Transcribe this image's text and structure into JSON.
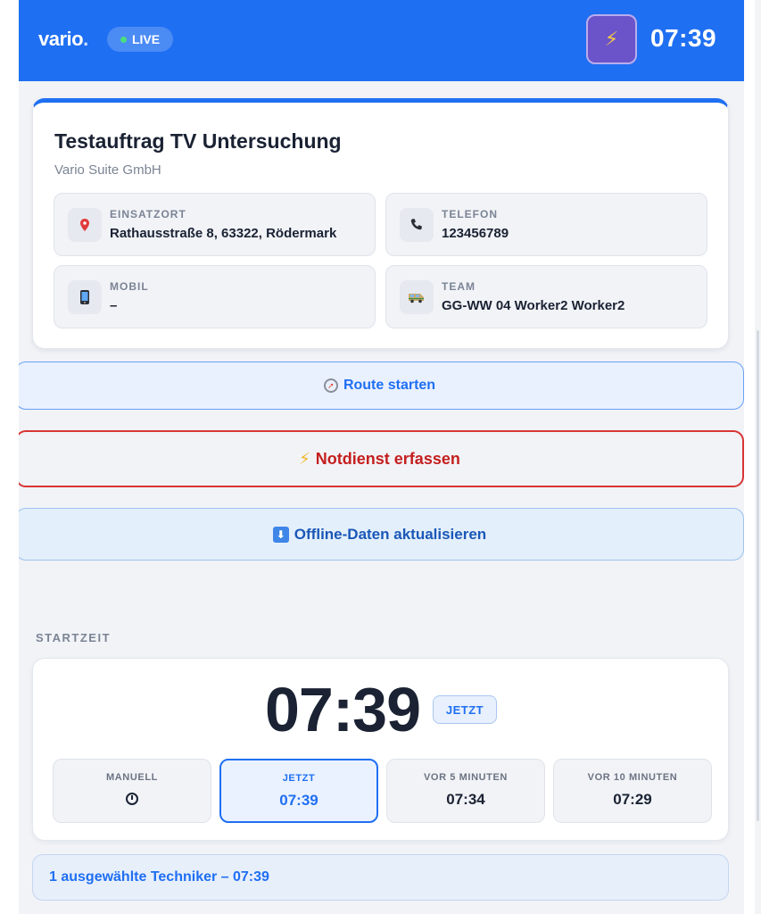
{
  "header": {
    "logo": "vario",
    "logo_dot": ".",
    "live_label": "LIVE",
    "emergency_icon": "lightning-bolt-icon",
    "clock": "07:39",
    "colors": {
      "bar": "#1f6ff2",
      "live_dot": "#4ade80",
      "bolt_button": "#6b54c9"
    }
  },
  "order": {
    "title": "Testauftrag TV Untersuchung",
    "company": "Vario Suite GmbH",
    "fields": [
      {
        "label": "EINSATZORT",
        "value": "Rathausstraße 8, 63322, Rödermark",
        "icon": "map-pin-icon"
      },
      {
        "label": "TELEFON",
        "value": "123456789",
        "icon": "phone-icon"
      },
      {
        "label": "MOBIL",
        "value": "–",
        "icon": "mobile-phone-icon"
      },
      {
        "label": "TEAM",
        "value": "GG-WW 04 Worker2 Worker2",
        "icon": "van-icon"
      }
    ]
  },
  "actions": {
    "route": {
      "label": "Route starten",
      "icon": "compass-icon"
    },
    "emergency": {
      "label": "Notdienst erfassen",
      "icon": "lightning-bolt-icon",
      "color": "#c41f1f"
    },
    "offline": {
      "label": "Offline-Daten aktualisieren",
      "icon": "download-arrow-icon"
    }
  },
  "startzeit": {
    "section_label": "STARTZEIT",
    "time": "07:39",
    "badge": "JETZT",
    "options": [
      {
        "label": "MANUELL",
        "value": "",
        "icon": "stopwatch-icon",
        "active": false
      },
      {
        "label": "JETZT",
        "value": "07:39",
        "active": true
      },
      {
        "label": "VOR 5 MINUTEN",
        "value": "07:34",
        "active": false
      },
      {
        "label": "VOR 10 MINUTEN",
        "value": "07:29",
        "active": false
      }
    ]
  },
  "summary": "1 ausgewählte Techniker – 07:39"
}
